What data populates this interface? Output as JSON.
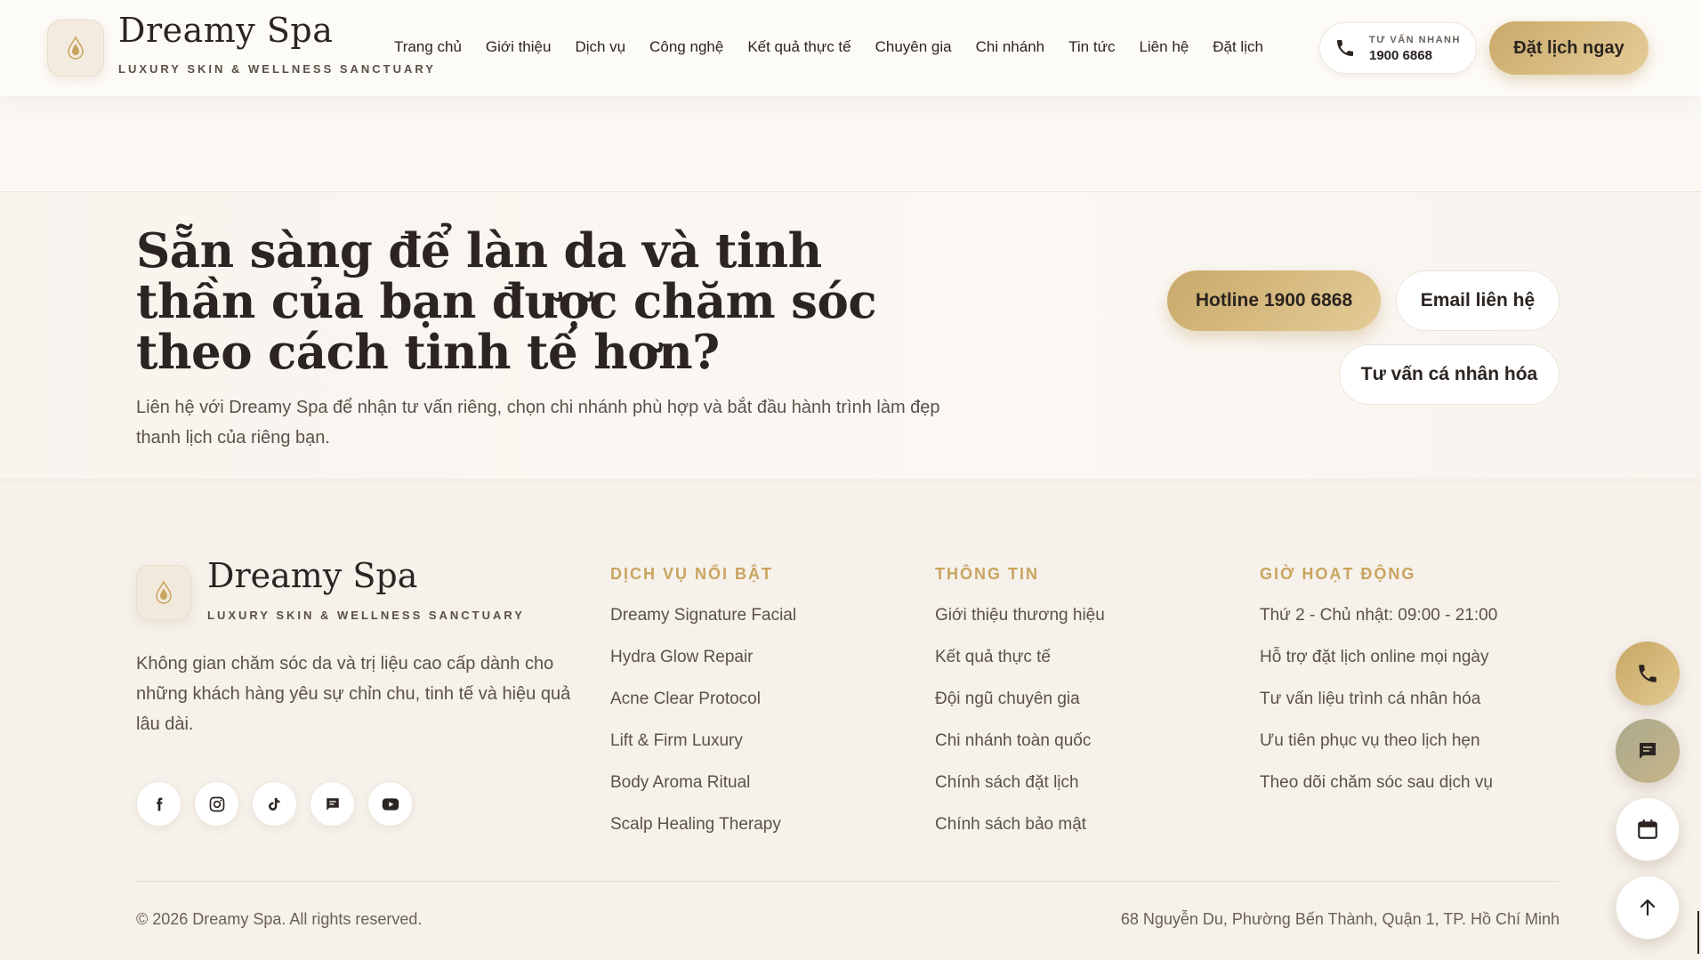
{
  "brand": {
    "name": "Dreamy Spa",
    "tagline": "LUXURY SKIN & WELLNESS SANCTUARY",
    "logo_icon": "lotus-drop-icon",
    "accent_color": "#c9a96a"
  },
  "nav": {
    "items": [
      "Trang chủ",
      "Giới thiệu",
      "Dịch vụ",
      "Công nghệ",
      "Kết quả thực tế",
      "Chuyên gia",
      "Chi nhánh",
      "Tin tức",
      "Liên hệ",
      "Đặt lịch"
    ]
  },
  "header": {
    "hotline_label": "TƯ VẤN NHANH",
    "hotline_number": "1900 6868",
    "book_label": "Đặt lịch ngay"
  },
  "cta": {
    "title": "Sẵn sàng để làn da và tinh thần của bạn được chăm sóc theo cách tinh tế hơn?",
    "description": "Liên hệ với Dreamy Spa để nhận tư vấn riêng, chọn chi nhánh phù hợp và bắt đầu hành trình làm đẹp thanh lịch của riêng bạn.",
    "hotline_button": "Hotline 1900 6868",
    "email_button": "Email liên hệ",
    "consult_button": "Tư vấn cá nhân hóa"
  },
  "footer": {
    "description": "Không gian chăm sóc da và trị liệu cao cấp dành cho những khách hàng yêu sự chỉn chu, tinh tế và hiệu quả lâu dài.",
    "socials": [
      "facebook-icon",
      "instagram-icon",
      "tiktok-icon",
      "message-icon",
      "youtube-icon"
    ],
    "columns": [
      {
        "heading": "DỊCH VỤ NỔI BẬT",
        "items": [
          "Dreamy Signature Facial",
          "Hydra Glow Repair",
          "Acne Clear Protocol",
          "Lift & Firm Luxury",
          "Body Aroma Ritual",
          "Scalp Healing Therapy"
        ]
      },
      {
        "heading": "THÔNG TIN",
        "items": [
          "Giới thiệu thương hiệu",
          "Kết quả thực tế",
          "Đội ngũ chuyên gia",
          "Chi nhánh toàn quốc",
          "Chính sách đặt lịch",
          "Chính sách bảo mật"
        ]
      },
      {
        "heading": "GIỜ HOẠT ĐỘNG",
        "items": [
          "Thứ 2 - Chủ nhật: 09:00 - 21:00",
          "Hỗ trợ đặt lịch online mọi ngày",
          "Tư vấn liệu trình cá nhân hóa",
          "Ưu tiên phục vụ theo lịch hẹn",
          "Theo dõi chăm sóc sau dịch vụ"
        ]
      }
    ],
    "copyright": "© 2026 Dreamy Spa. All rights reserved.",
    "address": "68 Nguyễn Du, Phường Bến Thành, Quận 1, TP. Hồ Chí Minh"
  },
  "floating": [
    "phone-icon",
    "chat-icon",
    "calendar-icon",
    "arrow-up-icon"
  ]
}
